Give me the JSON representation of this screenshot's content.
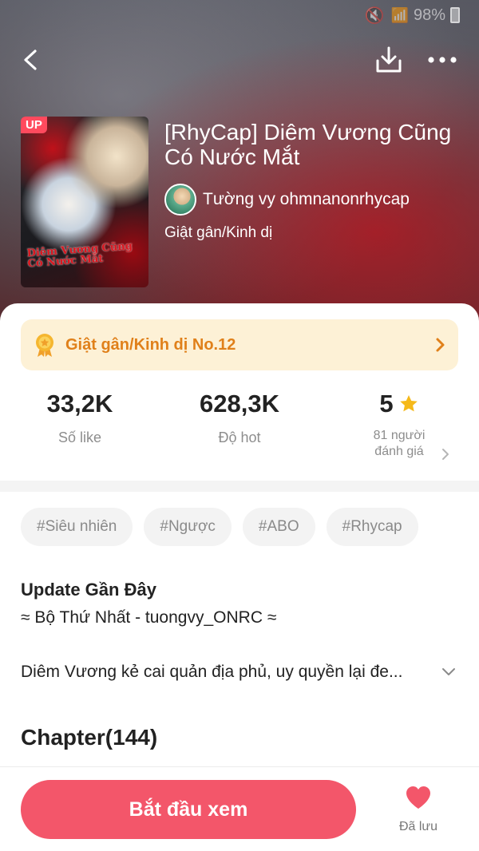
{
  "status_bar": {
    "battery": "98%"
  },
  "nav": {
    "back_icon": "back-icon",
    "download_icon": "download-icon",
    "more_icon": "more-icon"
  },
  "book": {
    "cover_badge": "UP",
    "cover_art_title": "Diêm Vương Cũng Có Nước Mắt",
    "title": "[RhyCap] Diêm Vương Cũng Có Nước Mắt",
    "author": "Tường vy ohmnanonrhycap",
    "genre": "Giật gân/Kinh dị"
  },
  "rank": {
    "label": "Giật gân/Kinh dị No.12",
    "color": "#e0801a",
    "background": "#fdf1d6"
  },
  "stats": {
    "likes": {
      "value": "33,2K",
      "label": "Số like"
    },
    "hot": {
      "value": "628,3K",
      "label": "Độ hot"
    },
    "rating": {
      "value": "5",
      "label_line1": "81 người",
      "label_line2": "đánh giá"
    }
  },
  "tags": [
    "#Siêu nhiên",
    "#Ngược",
    "#ABO",
    "#Rhycap"
  ],
  "update": {
    "heading": "Update Gần Đây",
    "text": "≈ Bộ Thứ Nhất - tuongvy_ONRC ≈"
  },
  "synopsis": "Diêm Vương kẻ cai quản địa phủ, uy quyền lại đe...",
  "chapters": {
    "heading": "Chapter(144)"
  },
  "bottom": {
    "start_label": "Bắt đầu xem",
    "save_label": "Đã lưu"
  },
  "colors": {
    "accent": "#f3566a",
    "star": "#f5b91a",
    "heart": "#f3566a"
  }
}
